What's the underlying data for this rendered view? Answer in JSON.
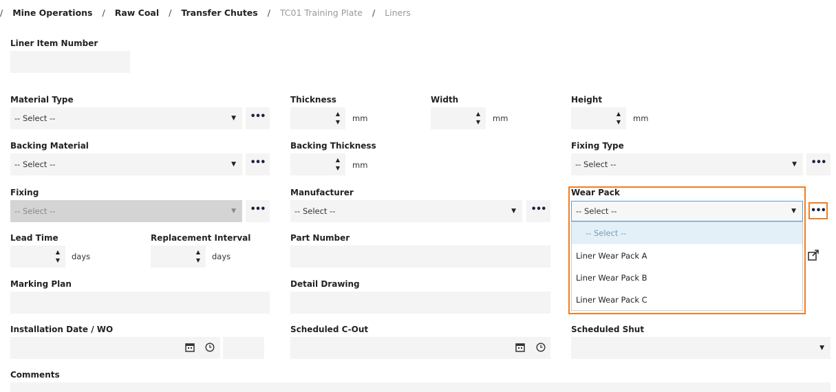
{
  "breadcrumb": {
    "sep": "/",
    "items": [
      "Mine Operations",
      "Raw Coal",
      "Transfer Chutes",
      "TC01 Training Plate",
      "Liners"
    ]
  },
  "fields": {
    "liner_item_number": {
      "label": "Liner Item Number",
      "value": ""
    },
    "material_type": {
      "label": "Material Type",
      "value": "-- Select --"
    },
    "thickness": {
      "label": "Thickness",
      "unit": "mm"
    },
    "width": {
      "label": "Width",
      "unit": "mm"
    },
    "height": {
      "label": "Height",
      "unit": "mm"
    },
    "backing_material": {
      "label": "Backing Material",
      "value": "-- Select --"
    },
    "backing_thickness": {
      "label": "Backing Thickness",
      "unit": "mm"
    },
    "fixing_type": {
      "label": "Fixing Type",
      "value": "-- Select --"
    },
    "fixing": {
      "label": "Fixing",
      "value": "-- Select --"
    },
    "manufacturer": {
      "label": "Manufacturer",
      "value": "-- Select --"
    },
    "wear_pack": {
      "label": "Wear Pack",
      "value": "-- Select --"
    },
    "lead_time": {
      "label": "Lead Time",
      "unit": "days"
    },
    "replacement_interval": {
      "label": "Replacement Interval",
      "unit": "days"
    },
    "part_number": {
      "label": "Part Number"
    },
    "marking_plan": {
      "label": "Marking Plan"
    },
    "detail_drawing": {
      "label": "Detail Drawing"
    },
    "installation_date": {
      "label": "Installation Date / WO"
    },
    "scheduled_cout": {
      "label": "Scheduled C-Out"
    },
    "scheduled_shut": {
      "label": "Scheduled Shut"
    },
    "comments": {
      "label": "Comments"
    }
  },
  "wear_pack_options": [
    "-- Select --",
    "Liner Wear Pack A",
    "Liner Wear Pack B",
    "Liner Wear Pack C"
  ],
  "glyphs": {
    "dots": "•••",
    "arrow": "▼",
    "up": "▲",
    "down": "▼",
    "calendar": "📅",
    "clock": "🕒",
    "external": "↗"
  },
  "colors": {
    "highlight": "#ef7d22",
    "focus_border": "#5b9bd5"
  }
}
